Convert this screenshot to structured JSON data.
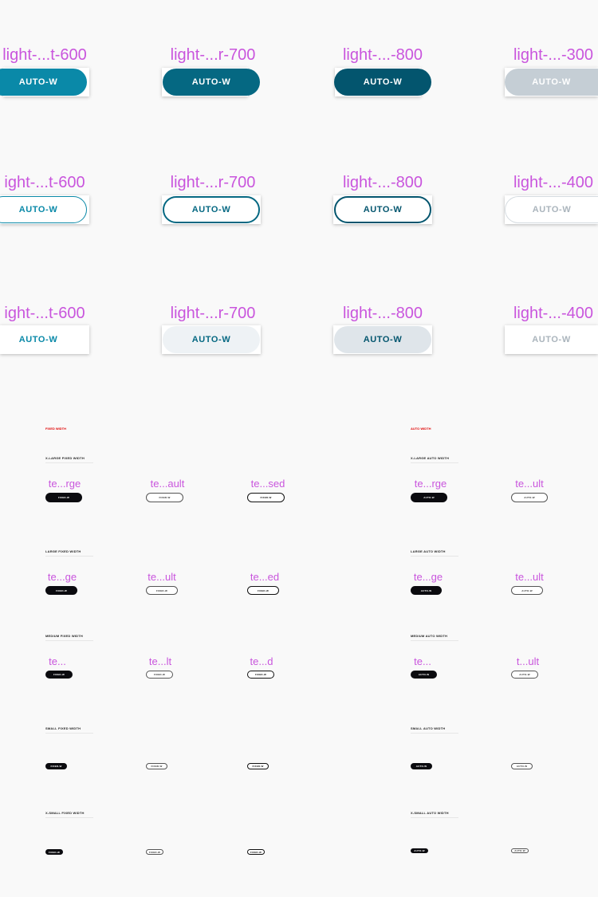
{
  "colors": {
    "label": "#c955dd",
    "accent600": "#0a89a8",
    "accent700": "#056882",
    "accent800": "#03556e",
    "disabled": "#c5ced5"
  },
  "showcase": {
    "row1": {
      "labels": [
        "light-...t-600",
        "light-...r-700",
        "light-...-800",
        "light-...-300"
      ],
      "button_label": "AUTO-W"
    },
    "row2": {
      "labels": [
        "ight-...t-600",
        "light-...r-700",
        "light-...-800",
        "light-...-400"
      ],
      "button_label": "AUTO-W"
    },
    "row3": {
      "labels": [
        "ight-...t-600",
        "light-...r-700",
        "light-...-800",
        "light-...-400"
      ],
      "button_label": "AUTO-W"
    }
  },
  "fixed": {
    "header": "FIXED WIDTH",
    "sections": [
      {
        "title": "X-LARGE FIXED WIDTH",
        "labels": [
          "te...rge",
          "te...ault",
          "te...sed"
        ],
        "button_label": "FIXED-W"
      },
      {
        "title": "LARGE FIXED WIDTH",
        "labels": [
          "te...ge",
          "te...ult",
          "te...ed"
        ],
        "button_label": "FIXED-W"
      },
      {
        "title": "MEDIUM FIXED WIDTH",
        "labels": [
          "te...",
          "te...lt",
          "te...d"
        ],
        "button_label": "FIXED-W"
      },
      {
        "title": "SMALL FIXED WIDTH",
        "labels": [
          "",
          "",
          ""
        ],
        "button_label": "FIXED-W"
      },
      {
        "title": "X-SMALL FIXED WIDTH",
        "labels": [
          "",
          "",
          ""
        ],
        "button_label": "FIXED-W"
      }
    ]
  },
  "auto": {
    "header": "AUTO WIDTH",
    "sections": [
      {
        "title": "X-LARGE AUTO WIDTH",
        "labels": [
          "te...rge",
          "te...ult"
        ],
        "button_label": "AUTO-W"
      },
      {
        "title": "LARGE AUTO WIDTH",
        "labels": [
          "te...ge",
          "te...ult"
        ],
        "button_label": "AUTO-W"
      },
      {
        "title": "MEDIUM AUTO WIDTH",
        "labels": [
          "te...",
          "t...ult"
        ],
        "button_label": "AUTO-W"
      },
      {
        "title": "SMALL AUTO WIDTH",
        "labels": [
          "",
          ""
        ],
        "button_label": "AUTO-W"
      },
      {
        "title": "X-SMALL AUTO WIDTH",
        "labels": [
          "",
          ""
        ],
        "button_label": "AUTO-W"
      }
    ]
  }
}
